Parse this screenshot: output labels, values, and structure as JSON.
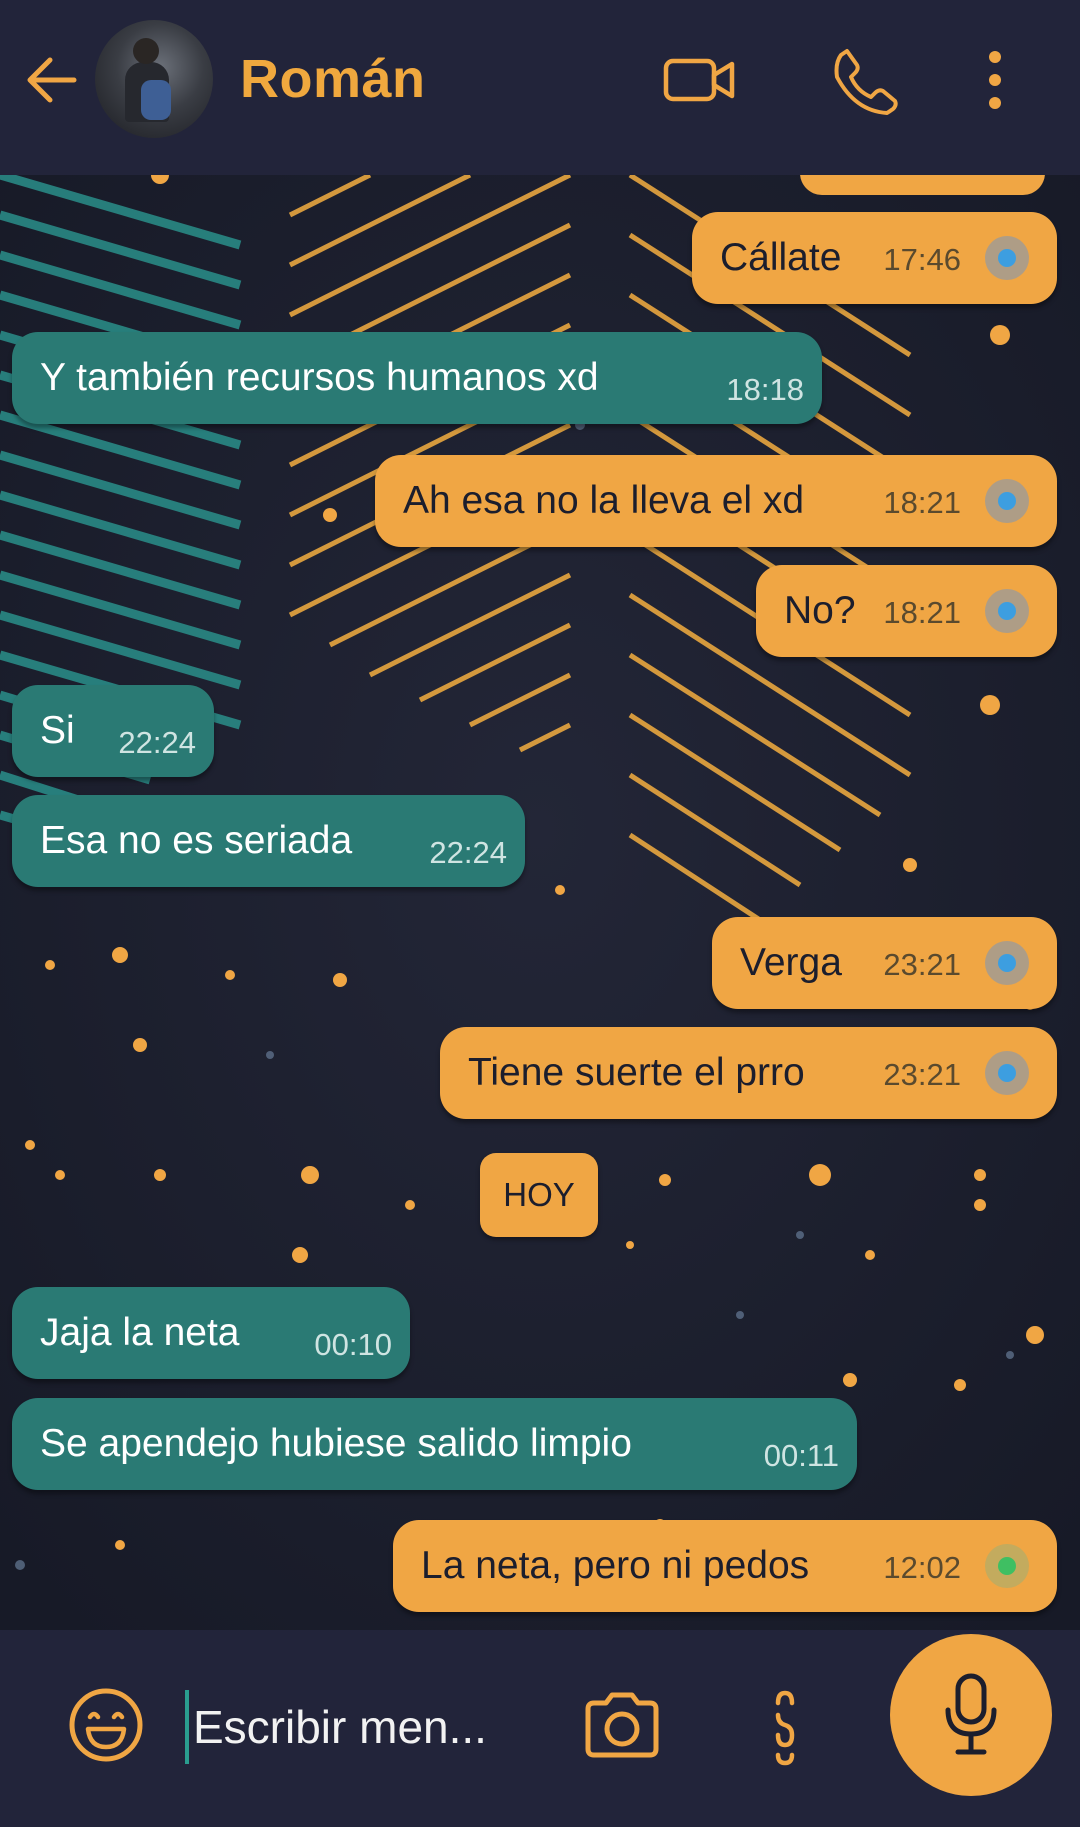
{
  "header": {
    "contact_name": "Román",
    "icons": [
      "back-arrow-icon",
      "avatar",
      "video-camera-icon",
      "phone-icon",
      "more-vert-icon"
    ]
  },
  "messages": [
    {
      "direction": "out",
      "text": "Cállate",
      "time": "17:46",
      "status": "delivered"
    },
    {
      "direction": "in",
      "text": "Y también recursos humanos xd",
      "time": "18:18"
    },
    {
      "direction": "out",
      "text": "Ah esa no la lleva el xd",
      "time": "18:21",
      "status": "delivered"
    },
    {
      "direction": "out",
      "text": "No?",
      "time": "18:21",
      "status": "delivered"
    },
    {
      "direction": "in",
      "text": "Si",
      "time": "22:24"
    },
    {
      "direction": "in",
      "text": "Esa no es seriada",
      "time": "22:24"
    },
    {
      "direction": "out",
      "text": "Verga",
      "time": "23:21",
      "status": "delivered"
    },
    {
      "direction": "out",
      "text": "Tiene suerte el prro",
      "time": "23:21",
      "status": "delivered"
    },
    {
      "direction": "in",
      "text": "Jaja la neta",
      "time": "00:10"
    },
    {
      "direction": "in",
      "text": "Se apendejo hubiese salido limpio",
      "time": "00:11"
    },
    {
      "direction": "out",
      "text": "La neta, pero ni pedos",
      "time": "12:02",
      "status": "sent"
    }
  ],
  "date_separator": "HOY",
  "input": {
    "placeholder": "Escribir men..."
  },
  "colors": {
    "accent": "#f0a644",
    "incoming_bubble": "#2a7a74",
    "header_bg": "#22243a",
    "status_delivered": "#3d9ee0",
    "status_sent": "#3fbf62"
  }
}
